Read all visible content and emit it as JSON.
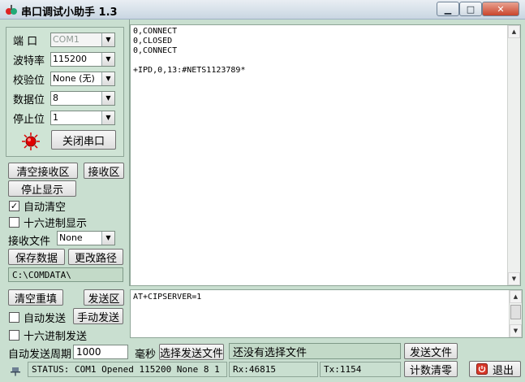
{
  "window": {
    "title": "串口调试小助手 1.3",
    "minimize_glyph": "▁",
    "maximize_glyph": "□",
    "close_glyph": "✕"
  },
  "serial": {
    "port_label": "端  口",
    "port_value": "COM1",
    "baud_label": "波特率",
    "baud_value": "115200",
    "parity_label": "校验位",
    "parity_value": "None (无)",
    "databits_label": "数据位",
    "databits_value": "8",
    "stopbits_label": "停止位",
    "stopbits_value": "1",
    "close_port_label": "关闭串口"
  },
  "receive": {
    "clear_label": "清空接收区",
    "area_label": "接收区",
    "stop_display_label": "停止显示",
    "auto_clear_label": "自动清空",
    "auto_clear_checked": "✓",
    "hex_display_label": "十六进制显示",
    "file_label": "接收文件",
    "file_value": "None",
    "save_label": "保存数据",
    "change_path_label": "更改路径",
    "path_value": "C:\\COMDATA\\",
    "text": "0,CONNECT\n0,CLOSED\n0,CONNECT\n\n+IPD,0,13:#NETS1123789*"
  },
  "send": {
    "clear_label": "清空重填",
    "area_label": "发送区",
    "auto_send_label": "自动发送",
    "manual_send_label": "手动发送",
    "hex_send_label": "十六进制发送",
    "period_label": "自动发送周期",
    "period_value": "1000",
    "period_unit": "毫秒",
    "choose_file_label": "选择发送文件",
    "no_file_text": "还没有选择文件",
    "send_file_label": "发送文件",
    "text": "AT+CIPSERVER=1"
  },
  "status": {
    "text": "STATUS: COM1 Opened 115200 None  8 1",
    "rx": "Rx:46815",
    "tx": "Tx:1154",
    "reset_count_label": "计数清零",
    "exit_label": "退出"
  },
  "colors": {
    "panel_bg": "#c9dfd0",
    "indicator_red": "#e00000",
    "exit_icon": "#d8382a"
  }
}
